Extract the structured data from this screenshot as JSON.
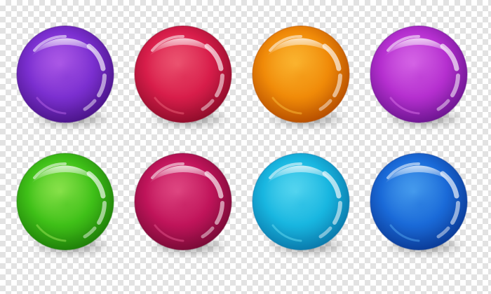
{
  "balls": [
    {
      "color": "purple",
      "base": "#7b2fd0",
      "light": "#c06af0",
      "dark": "#4a1488"
    },
    {
      "color": "red",
      "base": "#d81d4a",
      "light": "#f46a80",
      "dark": "#8e0c2a"
    },
    {
      "color": "orange",
      "base": "#f08a08",
      "light": "#ffc640",
      "dark": "#b54d00"
    },
    {
      "color": "magenta",
      "base": "#b52fcf",
      "light": "#e27aef",
      "dark": "#6c1590"
    },
    {
      "color": "green",
      "base": "#3fc018",
      "light": "#a8f060",
      "dark": "#1e7e08"
    },
    {
      "color": "crimson",
      "base": "#c0145a",
      "light": "#ec5c92",
      "dark": "#780a36"
    },
    {
      "color": "cyan",
      "base": "#18b6e0",
      "light": "#6ee2f6",
      "dark": "#0a78aa"
    },
    {
      "color": "blue",
      "base": "#1a6ad8",
      "light": "#58b0f6",
      "dark": "#0a3a96"
    }
  ]
}
